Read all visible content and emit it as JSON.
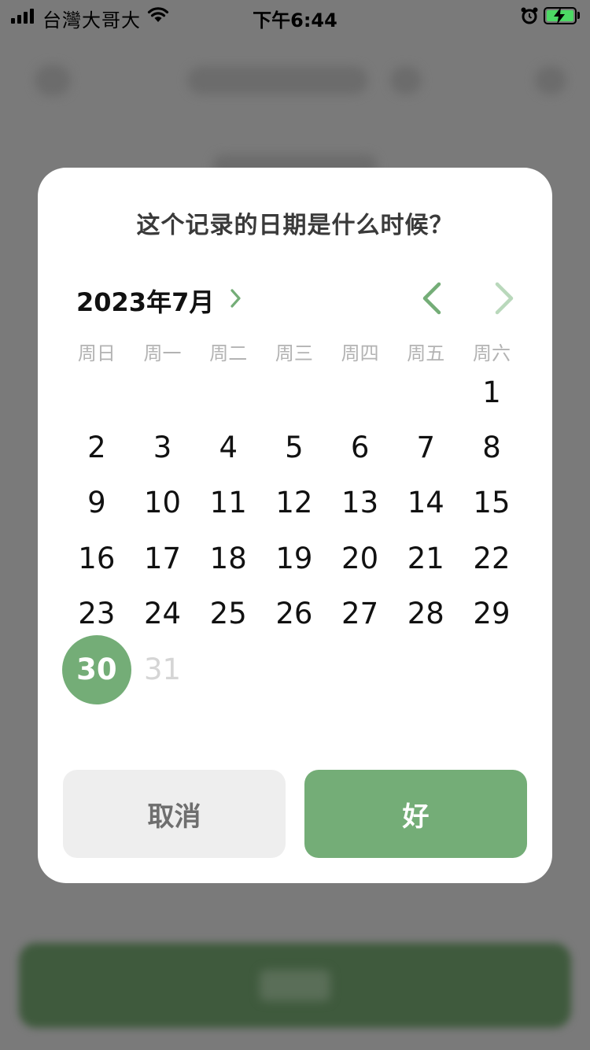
{
  "status_bar": {
    "carrier": "台灣大哥大",
    "time": "下午6:44"
  },
  "dialog": {
    "title": "这个记录的日期是什么时候？",
    "month_label": "2023年7月",
    "weekdays": [
      "周日",
      "周一",
      "周二",
      "周三",
      "周四",
      "周五",
      "周六"
    ],
    "weeks": [
      [
        "",
        "",
        "",
        "",
        "",
        "",
        "1"
      ],
      [
        "2",
        "3",
        "4",
        "5",
        "6",
        "7",
        "8"
      ],
      [
        "9",
        "10",
        "11",
        "12",
        "13",
        "14",
        "15"
      ],
      [
        "16",
        "17",
        "18",
        "19",
        "20",
        "21",
        "22"
      ],
      [
        "23",
        "24",
        "25",
        "26",
        "27",
        "28",
        "29"
      ],
      [
        "30",
        "31",
        "",
        "",
        "",
        "",
        ""
      ]
    ],
    "selected_day": "30",
    "disabled_days": [
      "31"
    ],
    "cancel_label": "取消",
    "ok_label": "好"
  },
  "colors": {
    "accent": "#74ad77",
    "accent_light": "#b9d8bb",
    "cancel_bg": "#eeeeee"
  }
}
